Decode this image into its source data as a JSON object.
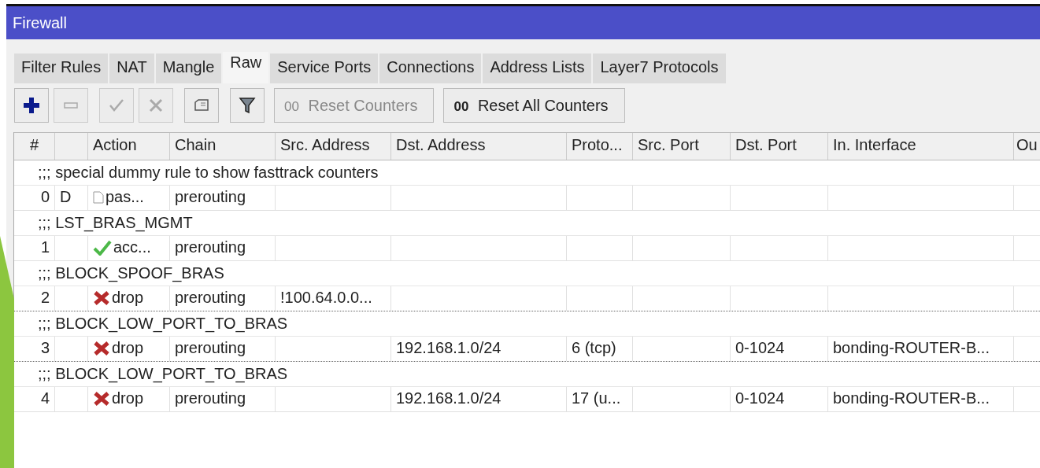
{
  "window": {
    "title": "Firewall"
  },
  "tabs": [
    {
      "label": "Filter Rules",
      "selected": false
    },
    {
      "label": "NAT",
      "selected": false
    },
    {
      "label": "Mangle",
      "selected": false
    },
    {
      "label": "Raw",
      "selected": true
    },
    {
      "label": "Service Ports",
      "selected": false
    },
    {
      "label": "Connections",
      "selected": false
    },
    {
      "label": "Address Lists",
      "selected": false
    },
    {
      "label": "Layer7 Protocols",
      "selected": false
    }
  ],
  "toolbar": [
    {
      "kind": "add",
      "disabled": false
    },
    {
      "kind": "remove",
      "disabled": true
    },
    {
      "kind": "enable",
      "disabled": true
    },
    {
      "kind": "disable",
      "disabled": true
    },
    {
      "kind": "comment",
      "disabled": false
    },
    {
      "kind": "filter",
      "disabled": false
    },
    {
      "kind": "text",
      "icon_text": "00",
      "label": "Reset Counters",
      "disabled": true
    },
    {
      "kind": "text",
      "icon_text": "00",
      "label": "Reset All Counters",
      "disabled": false
    }
  ],
  "table": {
    "columns": [
      "#",
      null,
      "Action",
      "Chain",
      "Src. Address",
      "Dst. Address",
      "Proto...",
      "Src. Port",
      "Dst. Port",
      "In. Interface",
      "Ou"
    ],
    "rows": [
      {
        "kind": "comment",
        "text": ";;; special dummy rule to show fasttrack counters"
      },
      {
        "kind": "rule",
        "cells": [
          "0",
          "D",
          {
            "kind": "passthrough",
            "text": "pas..."
          },
          "prerouting",
          null,
          null,
          null,
          null,
          null,
          null,
          null
        ]
      },
      {
        "kind": "comment",
        "text": ";;; LST_BRAS_MGMT"
      },
      {
        "kind": "rule",
        "cells": [
          "1",
          null,
          {
            "kind": "accept",
            "text": "acc..."
          },
          "prerouting",
          null,
          null,
          null,
          null,
          null,
          null,
          null
        ]
      },
      {
        "kind": "comment",
        "text": ";;; BLOCK_SPOOF_BRAS"
      },
      {
        "kind": "rule",
        "cells": [
          "2",
          null,
          {
            "kind": "drop",
            "text": "drop"
          },
          "prerouting",
          "!100.64.0.0...",
          null,
          null,
          null,
          null,
          null,
          null
        ]
      },
      {
        "kind": "comment",
        "text": ";;; BLOCK_LOW_PORT_TO_BRAS"
      },
      {
        "kind": "rule",
        "cells": [
          "3",
          null,
          {
            "kind": "drop",
            "text": "drop"
          },
          "prerouting",
          null,
          "192.168.1.0/24",
          "6 (tcp)",
          null,
          "0-1024",
          "bonding-ROUTER-B...",
          null
        ]
      },
      {
        "kind": "comment",
        "text": ";;; BLOCK_LOW_PORT_TO_BRAS"
      },
      {
        "kind": "rule",
        "cells": [
          "4",
          null,
          {
            "kind": "drop",
            "text": "drop"
          },
          "prerouting",
          null,
          "192.168.1.0/24",
          "17 (u...",
          null,
          "0-1024",
          "bonding-ROUTER-B...",
          null
        ]
      }
    ]
  }
}
